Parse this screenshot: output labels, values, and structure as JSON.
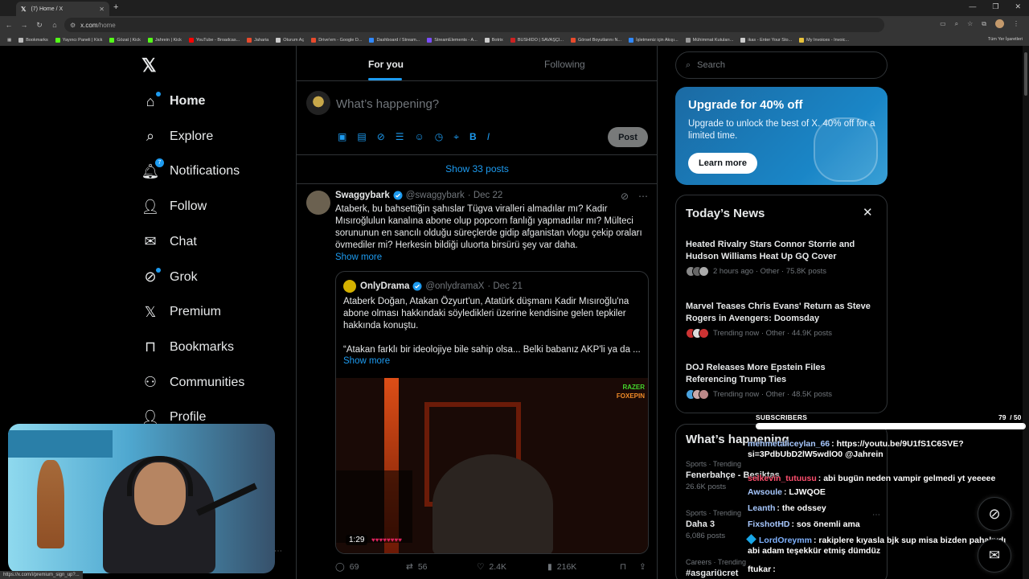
{
  "browser": {
    "tab_title": "(7) Home / X",
    "url_host": "x.com",
    "url_path": "/home",
    "new_tab": "+",
    "bookmarks": [
      {
        "label": "Bookmarks",
        "color": "#bbbbbb"
      },
      {
        "label": "Yayıncı Paneli | Kick",
        "color": "#53fc18"
      },
      {
        "label": "Gözat | Kick",
        "color": "#53fc18"
      },
      {
        "label": "Jahrein | Kick",
        "color": "#53fc18"
      },
      {
        "label": "YouTube - Broadcas...",
        "color": "#ff0000"
      },
      {
        "label": "Jaharia",
        "color": "#e84a2c"
      },
      {
        "label": "Oturum Aç",
        "color": "#cccccc"
      },
      {
        "label": "Drive'em - Google D...",
        "color": "#e84a2c"
      },
      {
        "label": "Dashboard / Stream...",
        "color": "#2f88ff"
      },
      {
        "label": "StreamElements - A...",
        "color": "#7b4dff"
      },
      {
        "label": "Botrix",
        "color": "#cccccc"
      },
      {
        "label": "BUSHIDO | SAVAŞÇI...",
        "color": "#cc2222"
      },
      {
        "label": "Görsel Boyutlarını N...",
        "color": "#e84a2c"
      },
      {
        "label": "İşletmeniz için Akışı...",
        "color": "#2f88ff"
      },
      {
        "label": "Mühimmat Kutuları...",
        "color": "#999999"
      },
      {
        "label": "ikas - Enter Your Sto...",
        "color": "#cccccc"
      },
      {
        "label": "My Invoices - Invoic...",
        "color": "#e8c23a"
      }
    ],
    "all_bookmarks": "Tüm Yer İşaretleri",
    "status_url": "https://x.com/i/premium_sign_up?..."
  },
  "nav": {
    "items": [
      {
        "label": "Home",
        "icon": "home-icon",
        "active": true
      },
      {
        "label": "Explore",
        "icon": "search-icon"
      },
      {
        "label": "Notifications",
        "icon": "bell-icon",
        "badge": "7"
      },
      {
        "label": "Follow",
        "icon": "follow-icon"
      },
      {
        "label": "Chat",
        "icon": "mail-icon"
      },
      {
        "label": "Grok",
        "icon": "grok-icon"
      },
      {
        "label": "Premium",
        "icon": "x-logo-icon"
      },
      {
        "label": "Bookmarks",
        "icon": "bookmark-icon"
      },
      {
        "label": "Communities",
        "icon": "communities-icon"
      },
      {
        "label": "Profile",
        "icon": "profile-icon"
      }
    ]
  },
  "feed": {
    "tabs": [
      "For you",
      "Following"
    ],
    "composer_placeholder": "What’s happening?",
    "post_label": "Post",
    "show_posts": "Show 33 posts",
    "tweet": {
      "name": "Swaggybark",
      "handle": "@swaggybark",
      "date": "· Dec 22",
      "text": "Ataberk, bu bahsettiğin şahıslar Tügva viralleri almadılar mı? Kadir Mısıroğlulun kanalına abone olup popcorn fanlığı yapmadılar mı? Mülteci sorununun en sancılı olduğu süreçlerde gidip afganistan vlogu çekip oraları övmediler mi? Herkesin bildiği uluorta birsürü şey var daha.",
      "show_more": "Show more",
      "quote": {
        "name": "OnlyDrama",
        "handle": "@onlydramaX",
        "date": "· Dec 21",
        "text": "Ataberk Doğan, Atakan Özyurt'un, Atatürk düşmanı Kadir Mısıroğlu'na abone olması hakkındaki söyledikleri üzerine kendisine gelen tepkiler hakkında konuştu.",
        "text2": "“Atakan farklı bir ideolojiye bile sahip olsa... Belki babanız AKP'li ya da ...",
        "show_more": "Show more",
        "video_time": "1:29",
        "brand1": "RAZER",
        "brand2": "FOXEPIN"
      },
      "replies": "69",
      "reposts": "56",
      "likes": "2.4K",
      "views": "216K"
    }
  },
  "sidebar": {
    "search_placeholder": "Search",
    "promo": {
      "title": "Upgrade for 40% off",
      "subtitle": "Upgrade to unlock the best of X. 40% off for a limited time.",
      "button": "Learn more"
    },
    "news_title": "Today’s News",
    "news": [
      {
        "headline": "Heated Rivalry Stars Connor Storrie and Hudson Williams Heat Up GQ Cover",
        "meta": "2 hours ago · Other · 75.8K posts"
      },
      {
        "headline": "Marvel Teases Chris Evans' Return as Steve Rogers in Avengers: Doomsday",
        "meta": "Trending now · Other · 44.9K posts"
      },
      {
        "headline": "DOJ Releases More Epstein Files Referencing Trump Ties",
        "meta": "Trending now · Other · 48.5K posts"
      }
    ],
    "happening_title": "What’s happening",
    "happening": [
      {
        "category": "Sports · Trending",
        "topic": "Fenerbahçe - Beşiktaş",
        "count": "26.6K posts"
      },
      {
        "category": "Sports · Trending",
        "topic": "Daha 3",
        "count": "6,086 posts"
      },
      {
        "category": "Careers · Trending",
        "topic": "#asgariücret",
        "count": ""
      }
    ]
  },
  "overlay": {
    "subs_label": "SUBSCRIBERS",
    "subs_count": "79",
    "subs_goal": "/ 50",
    "subs_fraction": 1.0,
    "chat": [
      {
        "user": "mehmetaliceylan_66",
        "color": "#a7c8ff",
        "msg": ": https://youtu.be/9U1fS1C6SVE?si=3PdbUbD2lW5wdlO0 @Jahrein"
      },
      {
        "user": "selkevin_tutuusu",
        "color": "#ff4f6e",
        "msg": ": abi bugün neden vampir gelmedi yt yeeeee"
      },
      {
        "user": "Awsoule",
        "color": "#a7c8ff",
        "msg": ": LJWQOE"
      },
      {
        "user": "Leanth",
        "color": "#a7c8ff",
        "msg": ": the odssey"
      },
      {
        "user": "FixshotHD",
        "color": "#a7c8ff",
        "msg": ": sos önemli ama"
      },
      {
        "user": "LordOreymm",
        "color": "#7fb2ff",
        "msg": ": rakiplere kıyasla bjk sup misa bizden pahalıydı abi adam teşekkür etmiş dümdüz",
        "badge": true
      },
      {
        "user": "ftukar",
        "color": "#ffffff",
        "msg": ": "
      }
    ]
  },
  "colors": {
    "accent": "#1d9bf0",
    "background": "#000000",
    "promo": "#1a86c7"
  }
}
